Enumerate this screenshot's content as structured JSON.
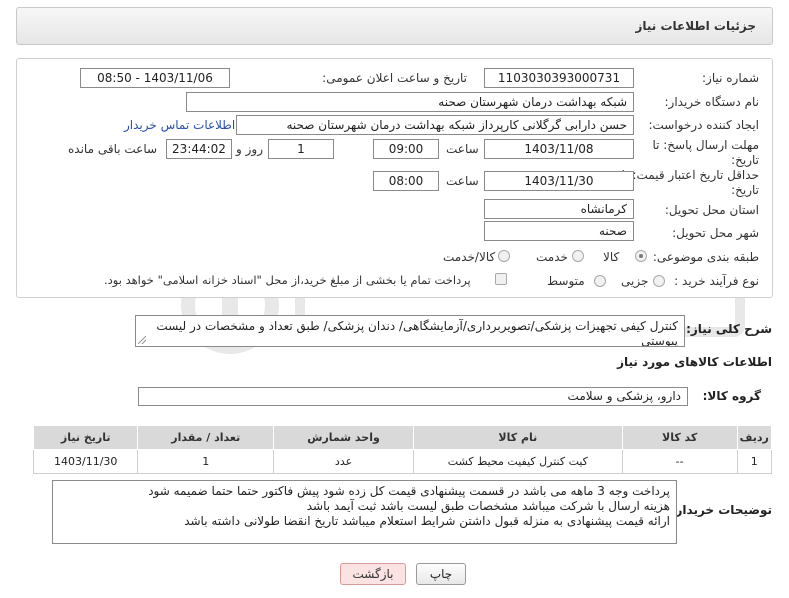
{
  "header": {
    "title": "جزئیات اطلاعات نیاز"
  },
  "form": {
    "need_number": {
      "label": "شماره نیاز:",
      "value": "1103030393000731"
    },
    "announce_datetime": {
      "label": "تاریخ و ساعت اعلان عمومی:",
      "value": "1403/11/06 - 08:50"
    },
    "buyer_org": {
      "label": "نام دستگاه خریدار:",
      "value": "شبکه بهداشت درمان شهرستان صحنه"
    },
    "creator": {
      "label": "ایجاد کننده درخواست:",
      "value": "حسن دارابی گرگلانی کارپرداز شبکه بهداشت درمان شهرستان صحنه",
      "contact_link": "اطلاعات تماس خریدار"
    },
    "reply_deadline": {
      "label_line1": "مهلت ارسال پاسخ: تا",
      "label_line2": "تاریخ:",
      "date": "1403/11/08",
      "time_label": "ساعت",
      "time": "09:00",
      "days": "1",
      "days_label": "روز و",
      "remaining": "23:44:02",
      "remaining_label": "ساعت باقی مانده"
    },
    "price_validity": {
      "label_line1": "حداقل تاریخ اعتبار قیمت: تا",
      "label_line2": "تاریخ:",
      "date": "1403/11/30",
      "time_label": "ساعت",
      "time": "08:00"
    },
    "province": {
      "label": "استان محل تحویل:",
      "value": "کرمانشاه"
    },
    "city": {
      "label": "شهر محل تحویل:",
      "value": "صحنه"
    },
    "category": {
      "label": "طبقه بندی موضوعی:",
      "options": [
        "کالا",
        "خدمت",
        "کالا/خدمت"
      ],
      "selected": "کالا"
    },
    "purchase_type": {
      "label": "نوع فرآیند خرید :",
      "options": [
        "جزیی",
        "متوسط"
      ],
      "checkbox_text": "پرداخت تمام یا بخشی از مبلغ خرید،از محل \"اسناد خزانه اسلامی\" خواهد بود."
    }
  },
  "description": {
    "label": "شرح کلی نیاز:",
    "value": "کنترل کیفی تجهیزات پزشکی/تصویربرداری/آزمایشگاهی/ دندان پزشکی/ طبق تعداد و مشخصات در لیست پیوستی"
  },
  "goods_info": {
    "title": "اطلاعات کالاهای مورد نیاز"
  },
  "goods_group": {
    "label": "گروه کالا:",
    "value": "دارو، پزشکی و سلامت"
  },
  "table": {
    "headers": [
      "ردیف",
      "کد کالا",
      "نام کالا",
      "واحد شمارش",
      "تعداد / مقدار",
      "تاریخ نیاز"
    ],
    "rows": [
      [
        "1",
        "--",
        "کیت کنترل کیفیت محیط کشت",
        "عدد",
        "1",
        "1403/11/30"
      ]
    ]
  },
  "buyer_notes": {
    "label": "توضیحات خریدار:",
    "lines": [
      "پرداخت وجه 3 ماهه می باشد در قسمت پیشنهادی قیمت کل زده شود پیش فاکتور حتما حتما ضمیمه شود",
      "هزینه ارسال با شرکت میباشد مشخصات طبق لیست باشد ثبت آیمد باشد",
      "ارائه قیمت پیشنهادی به منزله قبول داشتن شرایط استعلام میباشد تاریخ انقضا طولانی داشته باشد"
    ]
  },
  "buttons": {
    "print": "چاپ",
    "back": "بازگشت"
  },
  "colors": {
    "link": "#2b4fa8",
    "table_header": "#d9d9d9",
    "back_button": "#fbe3e3"
  }
}
